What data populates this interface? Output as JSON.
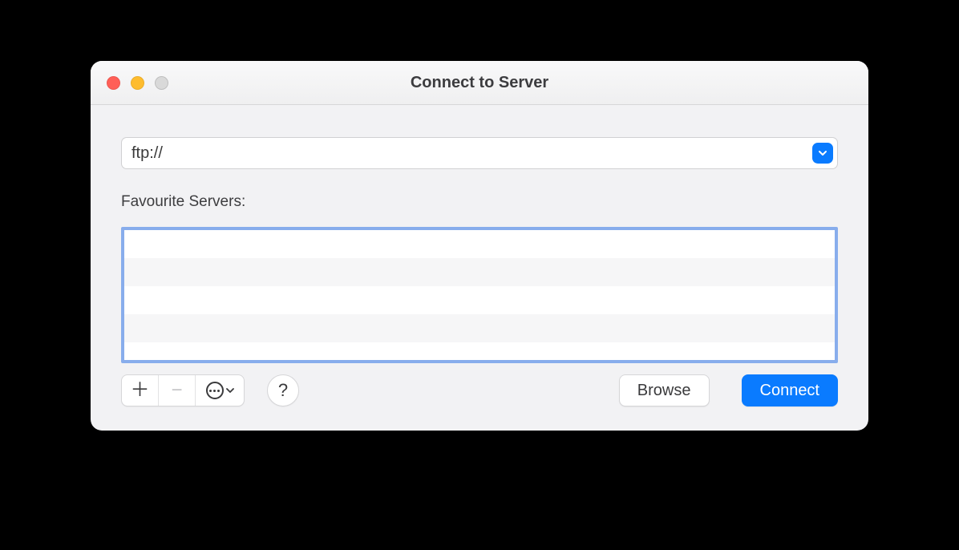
{
  "window": {
    "title": "Connect to Server"
  },
  "address": {
    "value": "ftp://",
    "placeholder": ""
  },
  "favourites": {
    "label": "Favourite Servers:",
    "items": []
  },
  "toolbar": {
    "help_label": "?"
  },
  "buttons": {
    "browse": "Browse",
    "connect": "Connect"
  },
  "colors": {
    "accent": "#0a7bff",
    "focus_ring": "#88adec"
  }
}
